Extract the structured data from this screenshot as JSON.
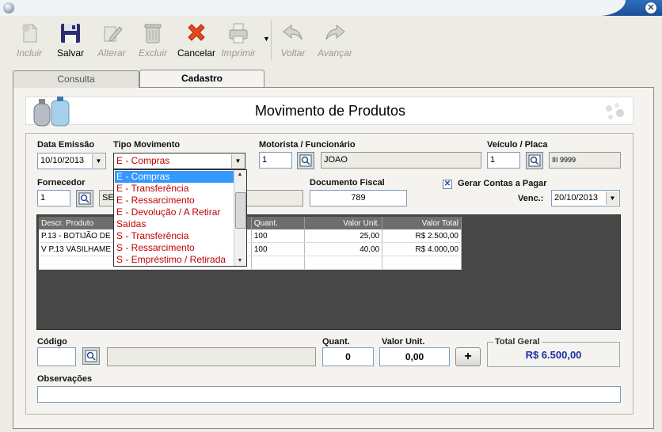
{
  "window": {
    "close_icon": "close-x-icon"
  },
  "toolbar": {
    "incluir": "Incluir",
    "salvar": "Salvar",
    "alterar": "Alterar",
    "excluir": "Excluir",
    "cancelar": "Cancelar",
    "imprimir": "Imprimir",
    "voltar": "Voltar",
    "avancar": "Avançar"
  },
  "tabs": {
    "consulta": "Consulta",
    "cadastro": "Cadastro"
  },
  "header": {
    "title": "Movimento de Produtos"
  },
  "form": {
    "data_emissao_label": "Data Emissão",
    "data_emissao": "10/10/2013",
    "tipo_movimento_label": "Tipo Movimento",
    "tipo_movimento": "E - Compras",
    "motorista_label": "Motorista / Funcionário",
    "motorista_code": "1",
    "motorista_name": "JOAO",
    "veiculo_label": "Veículo / Placa",
    "veiculo_code": "1",
    "veiculo_placa": "III 9999",
    "fornecedor_label": "Fornecedor",
    "fornecedor_code": "1",
    "fornecedor_name": "SE",
    "documento_label": "Documento Fiscal",
    "documento": "789",
    "gerar_contas_label": "Gerar Contas a Pagar",
    "venc_label": "Venc.:",
    "venc": "20/10/2013",
    "codigo_label": "Código",
    "quant_label": "Quant.",
    "quant": "0",
    "valor_unit_label": "Valor Unit.",
    "valor_unit": "0,00",
    "add_label": "+",
    "total_label": "Total Geral",
    "total": "R$ 6.500,00",
    "obs_label": "Observações"
  },
  "dropdown": {
    "options": [
      "E - Compras",
      "E - Transferência",
      "E - Ressarcimento",
      "E - Devolução / A Retirar",
      "Saídas",
      "S - Transferência",
      "S - Ressarcimento",
      "S - Empréstimo / Retirada"
    ]
  },
  "grid": {
    "headers": [
      "Descr. Produto",
      "Quant.",
      "Valor Unit.",
      "Valor Total"
    ],
    "rows": [
      [
        "P.13 - BOTIJÃO DE",
        "100",
        "25,00",
        "R$ 2.500,00"
      ],
      [
        "V P.13 VASILHAME",
        "100",
        "40,00",
        "R$ 4.000,00"
      ]
    ]
  },
  "colors": {
    "accent": "#1c4f95",
    "option_text": "#c00000",
    "selection": "#3399ff",
    "total_text": "#1a2ea8"
  }
}
